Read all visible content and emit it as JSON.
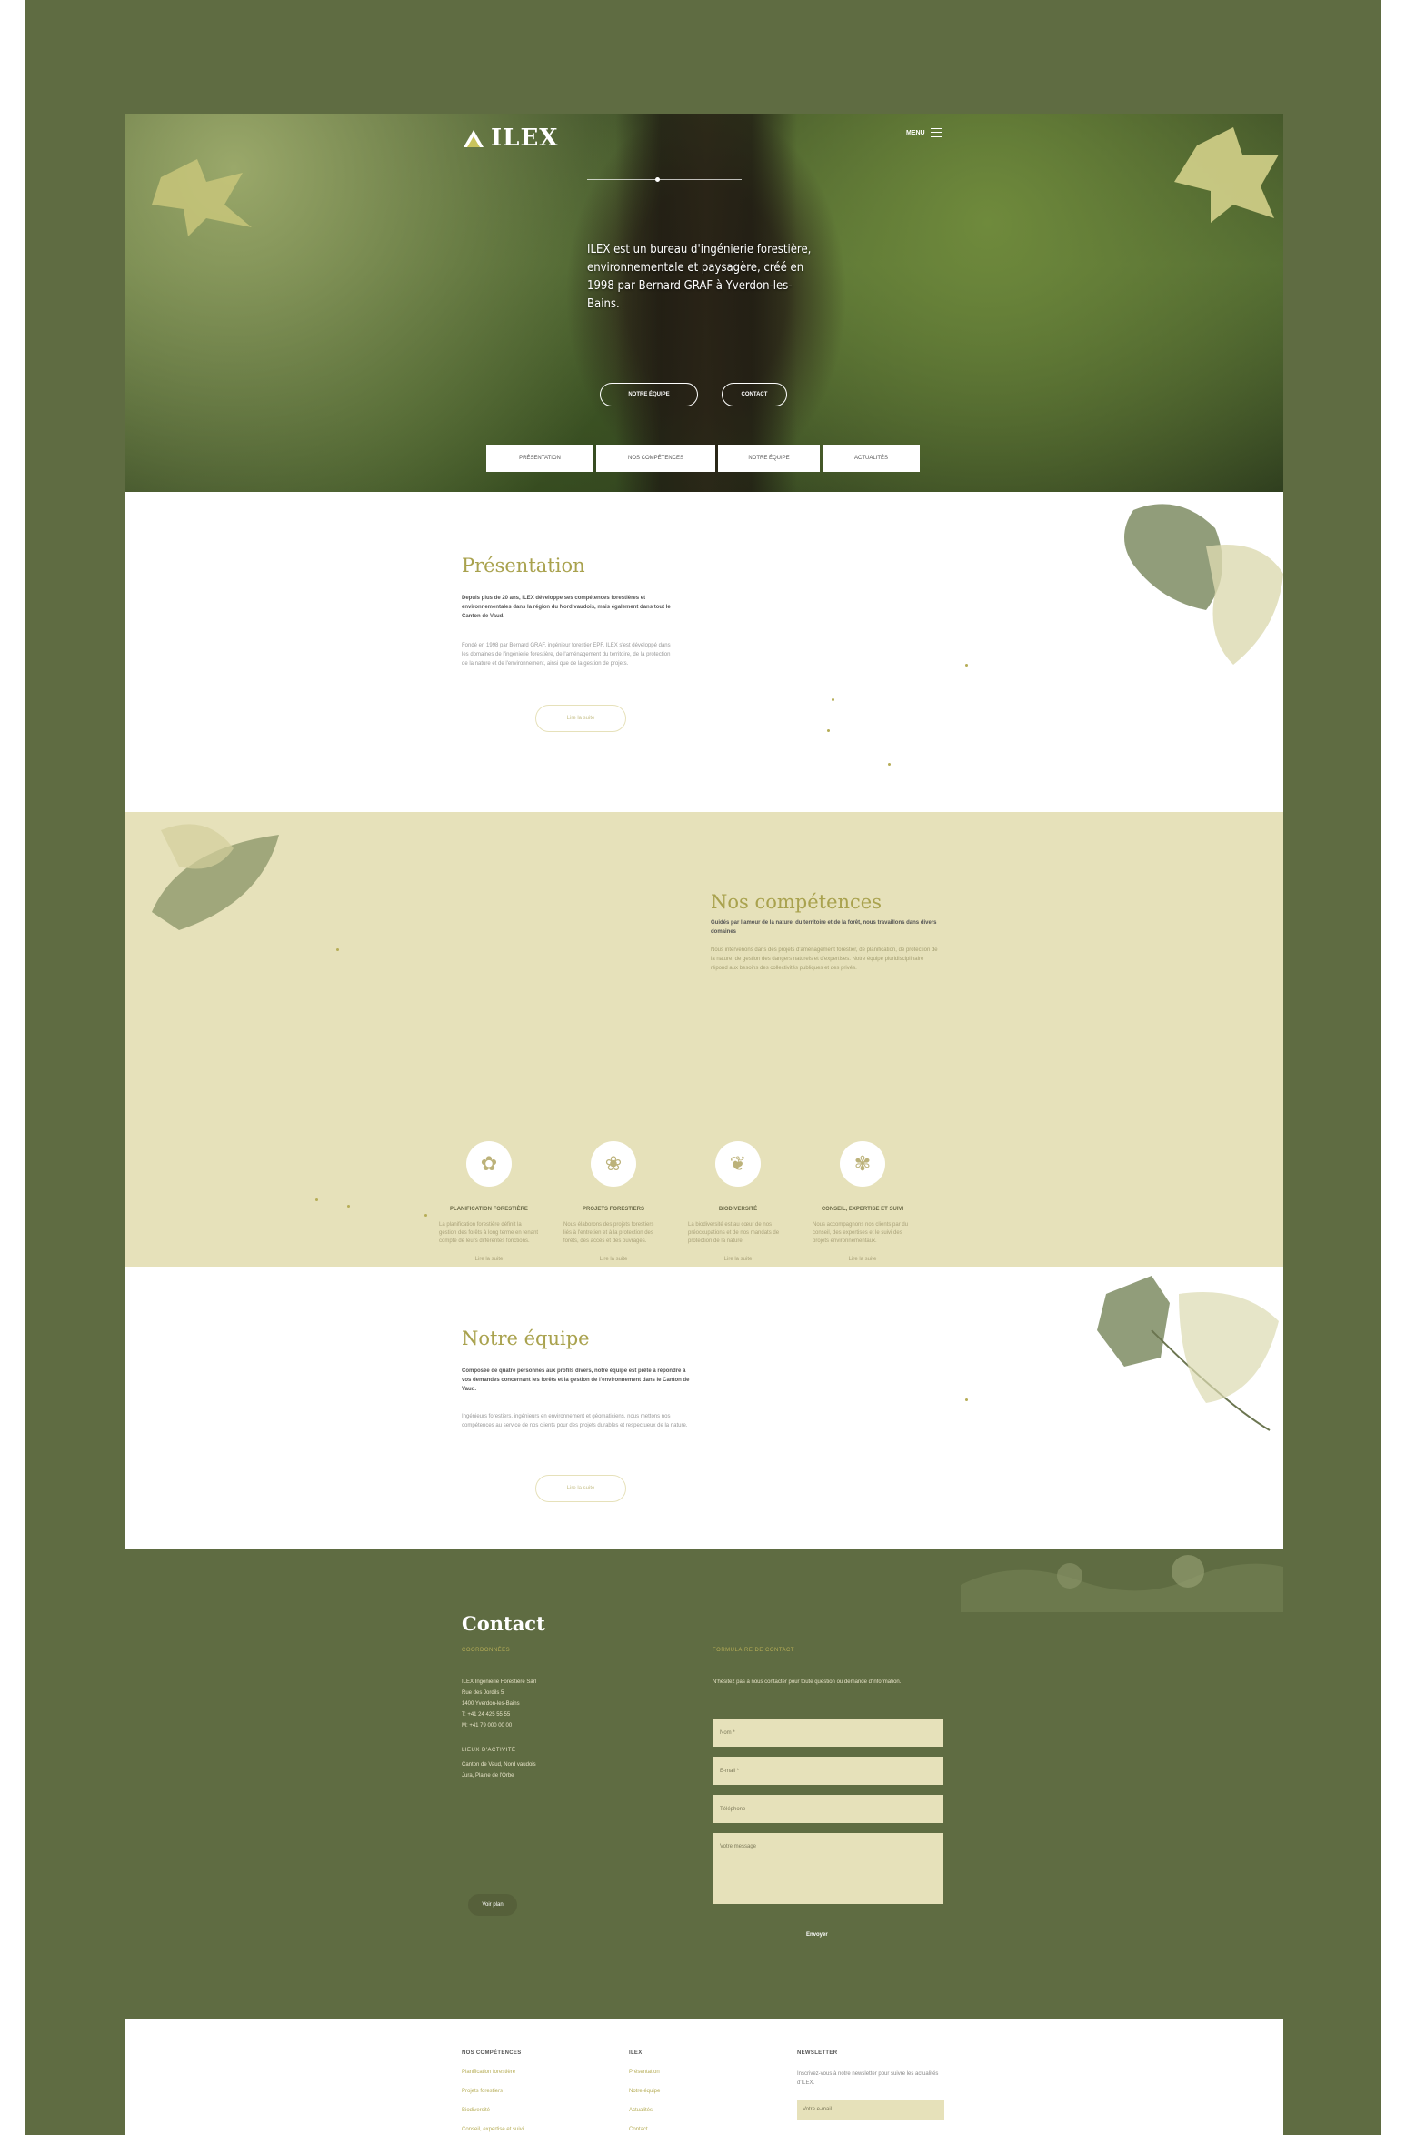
{
  "logo": {
    "text": "ILEX"
  },
  "header": {
    "menu_label": "MENU"
  },
  "hero": {
    "text": "ILEX est un bureau d'ingénierie forestière, environnementale et paysagère, créé en 1998 par Bernard GRAF à Yverdon-les-Bains.",
    "buttons": [
      "NOTRE ÉQUIPE",
      "CONTACT"
    ]
  },
  "tabs": [
    "PRÉSENTATION",
    "NOS COMPÉTENCES",
    "NOTRE ÉQUIPE",
    "ACTUALITÉS"
  ],
  "presentation": {
    "title": "Présentation",
    "lead": "Depuis plus de 20 ans, ILEX développe ses compétences forestières et environnementales dans la région du Nord vaudois, mais également dans tout le Canton de Vaud.",
    "body": "Fondé en 1998 par Bernard GRAF, ingénieur forestier EPF, ILEX s'est développé dans les domaines de l'ingénierie forestière, de l'aménagement du territoire, de la protection de la nature et de l'environnement, ainsi que de la gestion de projets.",
    "button": "Lire la suite"
  },
  "competences": {
    "title": "Nos compétences",
    "lead": "Guidés par l'amour de la nature, du territoire et de la forêt, nous travaillons dans divers domaines",
    "body": "Nous intervenons dans des projets d'aménagement forestier, de planification, de protection de la nature, de gestion des dangers naturels et d'expertises. Notre équipe pluridisciplinaire répond aux besoins des collectivités publiques et des privés.",
    "cards": [
      {
        "icon": "forest-planning-icon",
        "glyph": "✿",
        "title": "PLANIFICATION FORESTIÈRE",
        "desc": "La planification forestière définit la gestion des forêts à long terme en tenant compte de leurs différentes fonctions.",
        "more": "Lire la suite"
      },
      {
        "icon": "forest-project-icon",
        "glyph": "❀",
        "title": "PROJETS FORESTIERS",
        "desc": "Nous élaborons des projets forestiers liés à l'entretien et à la protection des forêts, des accès et des ouvrages.",
        "more": "Lire la suite"
      },
      {
        "icon": "biodiversity-icon",
        "glyph": "❦",
        "title": "BIODIVERSITÉ",
        "desc": "La biodiversité est au cœur de nos préoccupations et de nos mandats de protection de la nature.",
        "more": "Lire la suite"
      },
      {
        "icon": "expertise-icon",
        "glyph": "✾",
        "title": "CONSEIL, EXPERTISE ET SUIVI",
        "desc": "Nous accompagnons nos clients par du conseil, des expertises et le suivi des projets environnementaux.",
        "more": "Lire la suite"
      }
    ]
  },
  "team": {
    "title": "Notre équipe",
    "lead": "Composée de quatre personnes aux profils divers, notre équipe est prête à répondre à vos demandes concernant les forêts et la gestion de l'environnement dans le Canton de Vaud.",
    "body": "Ingénieurs forestiers, ingénieurs en environnement et géomaticiens, nous mettons nos compétences au service de nos clients pour des projets durables et respectueux de la nature.",
    "button": "Lire la suite"
  },
  "contact": {
    "title": "Contact",
    "coords_heading": "COORDONNÉES",
    "coords_lines": [
      "ILEX Ingénierie Forestière Sàrl",
      "Rue des Jordils 5",
      "1400 Yverdon-les-Bains",
      "T: +41 24 425 55 55",
      "M: +41 79 000 00 00"
    ],
    "second_heading": "LIEUX D'ACTIVITÉ",
    "second_lines": [
      "Canton de Vaud, Nord vaudois",
      "Jura, Plaine de l'Orbe"
    ],
    "map_button": "Voir plan",
    "form_heading": "FORMULAIRE DE CONTACT",
    "form_intro": "N'hésitez pas à nous contacter pour toute question ou demande d'information.",
    "fields": [
      "Nom *",
      "E-mail *",
      "Téléphone"
    ],
    "message_placeholder": "Votre message",
    "send": "Envoyer"
  },
  "footer": {
    "col1_heading": "NOS COMPÉTENCES",
    "col1_links": [
      "Planification forestière",
      "Projets forestiers",
      "Biodiversité",
      "Conseil, expertise et suivi"
    ],
    "col2_heading": "ILEX",
    "col2_links": [
      "Présentation",
      "Notre équipe",
      "Actualités",
      "Contact"
    ],
    "col3_heading": "NEWSLETTER",
    "col3_text": "Inscrivez-vous à notre newsletter pour suivre les actualités d'ILEX.",
    "newsletter_placeholder": "Votre e-mail"
  },
  "colors": {
    "frame": "#5f6c42",
    "beige": "#e6e1ba",
    "gold": "#a9a24e"
  }
}
